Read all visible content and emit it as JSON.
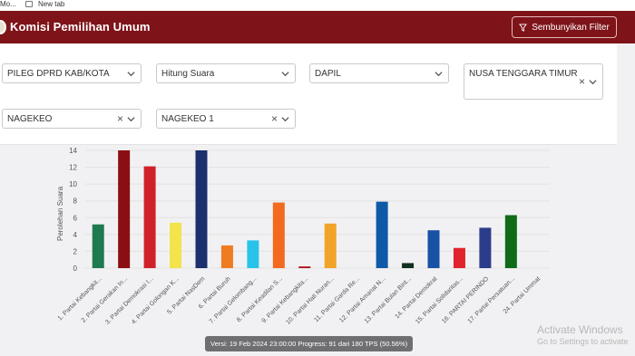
{
  "browser": {
    "tab_left": "Mo...",
    "new_tab": "New tab"
  },
  "header": {
    "title": "Komisi Pemilihan Umum",
    "filter_button": "Sembunyikan Filter"
  },
  "filters": {
    "row1": [
      {
        "label": "PILEG DPRD KAB/KOTA"
      },
      {
        "label": "Hitung Suara"
      },
      {
        "label": "DAPIL"
      },
      {
        "label": "NUSA TENGGARA TIMUR"
      }
    ],
    "row2": [
      {
        "label": "NAGEKEO"
      },
      {
        "label": "NAGEKEO 1"
      }
    ]
  },
  "chart_data": {
    "type": "bar",
    "ylabel": "Perolehan Suara",
    "ylim": [
      0,
      14
    ],
    "yticks": [
      0,
      2,
      4,
      6,
      8,
      10,
      12,
      14
    ],
    "categories": [
      "1. Partai Kebangkit...",
      "2. Partai Gerakan In...",
      "3. Partai Demokrasi I...",
      "4. Partai Golongan K...",
      "5. Partai NasDem",
      "6. Partai Buruh",
      "7. Partai Gelombang...",
      "8. Partai Keadilan S...",
      "9. Partai Kebangkita...",
      "10. Partai Hati Nuran...",
      "11. Partai Garda Re...",
      "12. Partai Amanat N...",
      "13. Partai Bulan Bint...",
      "14. Partai Demokrat",
      "15. Partai Solidaritas...",
      "16. PARTAI PERINDO",
      "17. Partai Persatuan...",
      "24. Partai Ummat"
    ],
    "values": [
      5.2,
      15,
      12.1,
      5.4,
      14.9,
      2.7,
      3.3,
      7.8,
      0.2,
      5.3,
      0,
      7.9,
      0.6,
      4.5,
      2.4,
      4.8,
      6.3,
      0
    ],
    "colors": [
      "#1f7a4f",
      "#8b0f12",
      "#d0212b",
      "#f2e44a",
      "#1c2f6e",
      "#f07c21",
      "#29c3ea",
      "#f26a1d",
      "#b3121b",
      "#f0a428",
      "#8f8f8f",
      "#0e5aa8",
      "#12301f",
      "#1851a6",
      "#e0232d",
      "#2b3d8a",
      "#0f6b18",
      "#404040"
    ]
  },
  "watermark": {
    "line1": "Activate Windows",
    "line2": "Go to Settings to activate"
  },
  "version_text": "Versi: 19 Feb 2024 23:00:00 Progress: 91 dari 180 TPS (50.56%)"
}
